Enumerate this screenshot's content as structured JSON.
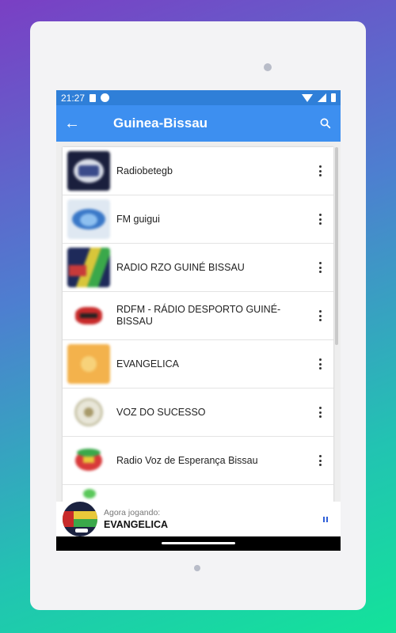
{
  "status_bar": {
    "time": "21:27"
  },
  "app_bar": {
    "title": "Guinea-Bissau"
  },
  "stations": [
    {
      "name": "Radiobetegb",
      "thumb": "radiobetegb-logo"
    },
    {
      "name": "FM guigui",
      "thumb": "fm-guigui-logo"
    },
    {
      "name": "RADIO RZO GUINÉ BISSAU",
      "thumb": "radio-rzo-logo"
    },
    {
      "name": "RDFM - RÁDIO DESPORTO GUINÉ-BISSAU",
      "thumb": "rdfm-logo"
    },
    {
      "name": "EVANGELICA",
      "thumb": "evangelica-logo"
    },
    {
      "name": "VOZ DO SUCESSO",
      "thumb": "voz-do-sucesso-logo"
    },
    {
      "name": "Radio Voz de Esperança Bissau",
      "thumb": "voz-esperanca-logo"
    }
  ],
  "now_playing": {
    "label": "Agora jogando:",
    "title": "EVANGELICA"
  },
  "colors": {
    "status_bar": "#2f7fd8",
    "app_bar": "#3d8ff0",
    "accent": "#2f5fd8"
  }
}
